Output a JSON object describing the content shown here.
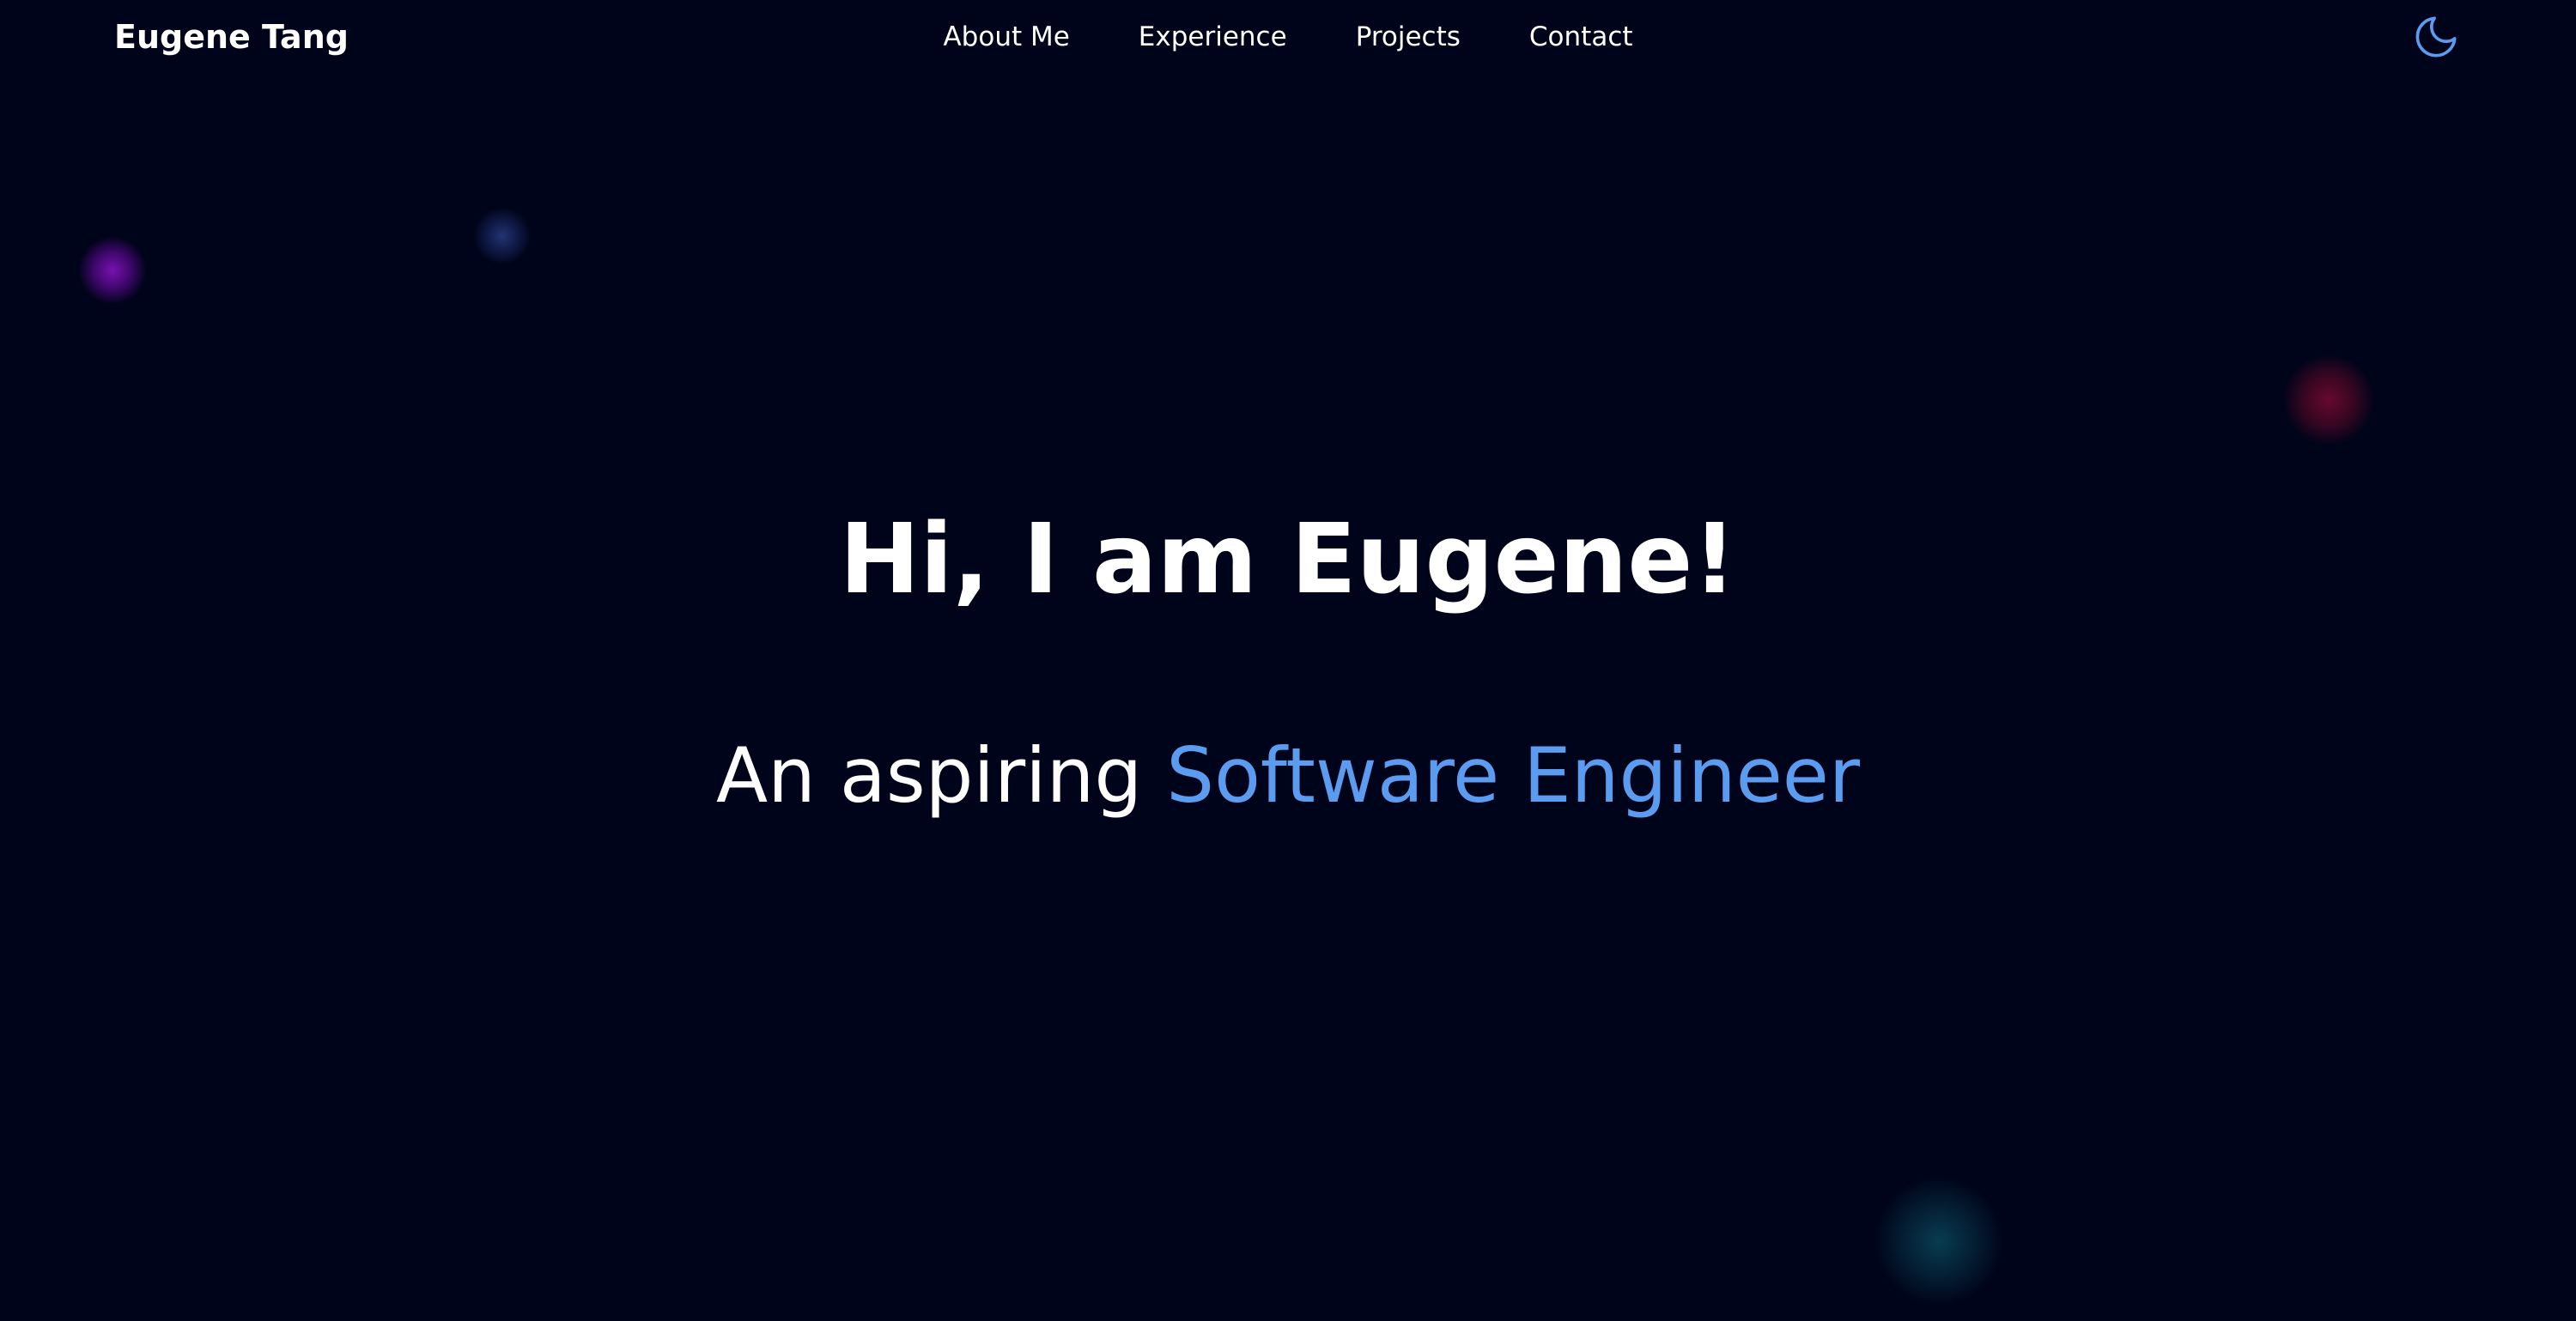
{
  "navbar": {
    "brand": "Eugene Tang",
    "links": [
      {
        "label": "About Me"
      },
      {
        "label": "Experience"
      },
      {
        "label": "Projects"
      },
      {
        "label": "Contact"
      }
    ],
    "theme_toggle_icon": "moon-icon"
  },
  "hero": {
    "title": "Hi, I am Eugene!",
    "subtitle_prefix": "An aspiring",
    "subtitle_highlight": "Software Engineer"
  },
  "colors": {
    "background": "#00041a",
    "text": "#ffffff",
    "accent": "#5b9cf0",
    "orb_purple": "#8c14c8",
    "orb_blue": "#283c82",
    "orb_red": "#780a32",
    "orb_teal": "#0a465a"
  }
}
